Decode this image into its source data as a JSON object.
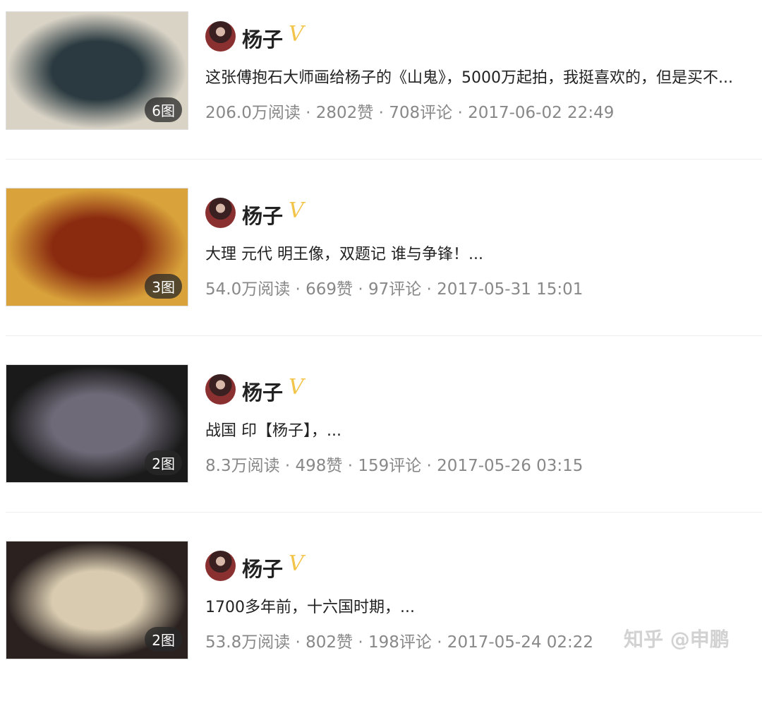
{
  "posts": [
    {
      "author": "杨子",
      "verified": "V",
      "images": "6图",
      "title": "这张傅抱石大师画给杨子的《山鬼》，5000万起拍，我挺喜欢的，但是买不...",
      "meta": "206.0万阅读 · 2802赞 · 708评论 · 2017-06-02 22:49",
      "thumb_colors": [
        "#d9d3c6",
        "#2a3a40"
      ]
    },
    {
      "author": "杨子",
      "verified": "V",
      "images": "3图",
      "title": "大理 元代 明王像，双题记 谁与争锋！...",
      "meta": "54.0万阅读 · 669赞 · 97评论 · 2017-05-31 15:01",
      "thumb_colors": [
        "#d9a23a",
        "#8a2b10"
      ]
    },
    {
      "author": "杨子",
      "verified": "V",
      "images": "2图",
      "title": "战国 印【杨子】，...",
      "meta": "8.3万阅读 · 498赞 · 159评论 · 2017-05-26 03:15",
      "thumb_colors": [
        "#1a1a1a",
        "#6f6a78"
      ]
    },
    {
      "author": "杨子",
      "verified": "V",
      "images": "2图",
      "title": "1700多年前，十六国时期，...",
      "meta": "53.8万阅读 · 802赞 · 198评论 · 2017-05-24 02:22",
      "thumb_colors": [
        "#2b2220",
        "#d8cbb0"
      ]
    }
  ],
  "watermark": "知乎 @申鹏"
}
